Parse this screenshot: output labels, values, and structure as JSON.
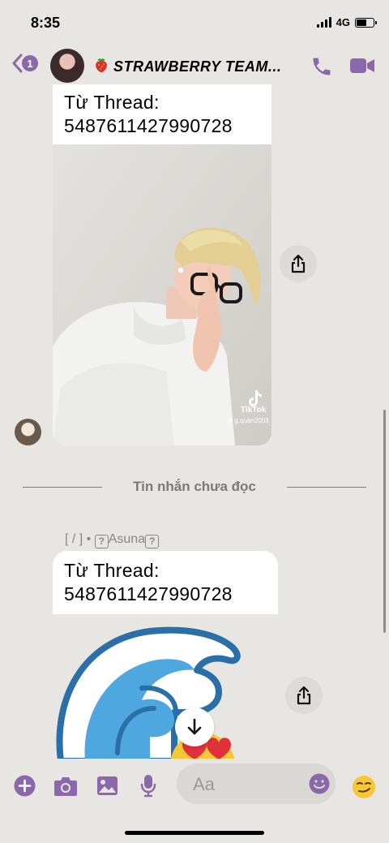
{
  "status_bar": {
    "time": "8:35",
    "network": "4G"
  },
  "header": {
    "back_badge": "1",
    "title": "STRAWBERRY TEAM..."
  },
  "messages": {
    "first": {
      "line1": "Từ Thread:",
      "line2": "5487611427990728"
    },
    "video": {
      "watermark": "TikTok",
      "handle": "@ g.quan2003"
    },
    "unread_label": "Tin nhắn chưa đọc",
    "second": {
      "sender_prefix": "[ / ] •",
      "sender_box": "?",
      "sender_name": "Asuna",
      "line1": "Từ Thread:",
      "line2": "5487611427990728"
    }
  },
  "composer": {
    "placeholder": "Aa"
  },
  "icons": {
    "back": "chevron-left-icon",
    "phone": "phone-icon",
    "video": "video-camera-icon",
    "share": "share-icon",
    "scroll_down": "arrow-down-icon",
    "add": "plus-icon",
    "camera": "camera-icon",
    "gallery": "image-icon",
    "mic": "microphone-icon",
    "emoji": "smiley-icon",
    "reaction": "smirk-emoji"
  },
  "colors": {
    "accent": "#8a68a9",
    "background": "#e8e6e3",
    "bubble": "#ffffff"
  }
}
